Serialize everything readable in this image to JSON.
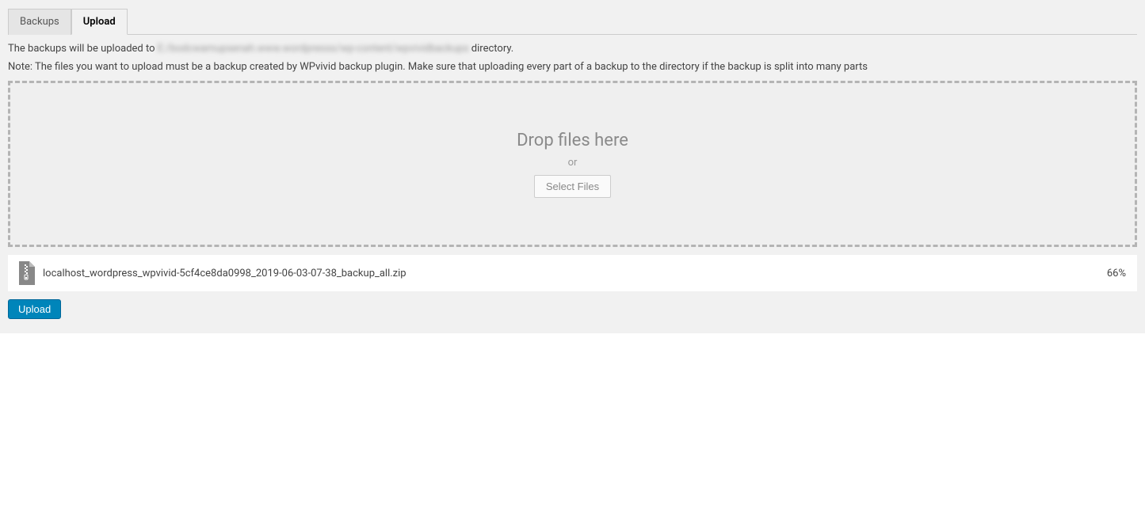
{
  "tabs": {
    "backups_label": "Backups",
    "upload_label": "Upload"
  },
  "info": {
    "upload_prefix": "The backups will be uploaded to ",
    "upload_path_blurred": "E:/bodcwamupsenah.www.wordpresss/wp-content/wpvividbackups",
    "upload_suffix": " directory.",
    "note": "Note: The files you want to upload must be a backup created by WPvivid backup plugin. Make sure that uploading every part of a backup to the directory if the backup is split into many parts"
  },
  "dropzone": {
    "title": "Drop files here",
    "or": "or",
    "select_btn": "Select Files"
  },
  "file": {
    "name": "localhost_wordpress_wpvivid-5cf4ce8da0998_2019-06-03-07-38_backup_all.zip",
    "percent": "66%"
  },
  "upload_button": "Upload"
}
